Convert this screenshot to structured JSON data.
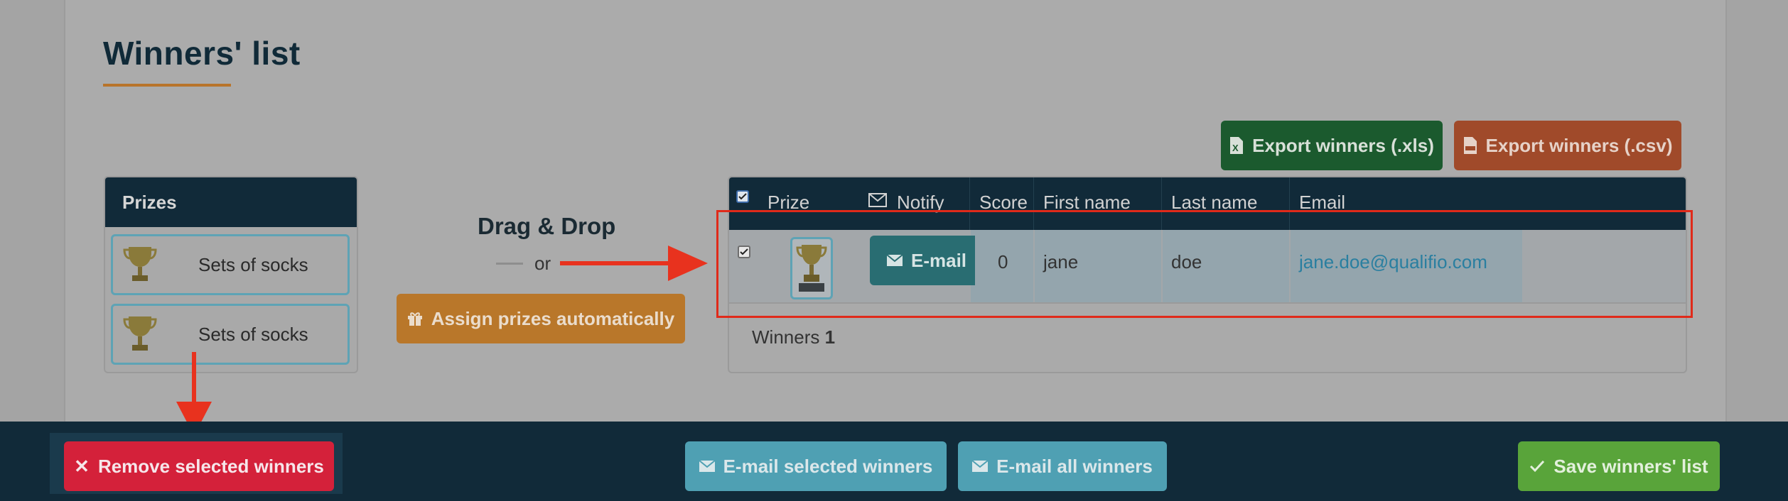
{
  "page": {
    "title": "Winners' list"
  },
  "export": {
    "xls_label": "Export winners (.xls)",
    "csv_label": "Export winners (.csv)"
  },
  "prizes": {
    "heading": "Prizes",
    "items": [
      {
        "label": "Sets of socks"
      },
      {
        "label": "Sets of socks"
      }
    ]
  },
  "drag_drop": {
    "title": "Drag & Drop",
    "or": "or",
    "assign_label": "Assign prizes automatically"
  },
  "table": {
    "headers": {
      "prize": "Prize",
      "notify": "Notify",
      "score": "Score",
      "first_name": "First name",
      "last_name": "Last name",
      "email": "Email"
    },
    "rows": [
      {
        "checked": true,
        "notify_label": "E-mail",
        "score": "0",
        "first_name": "jane",
        "last_name": "doe",
        "email": "jane.doe@qualifio.com"
      }
    ],
    "footer_label": "Winners",
    "footer_count": "1"
  },
  "bottom_bar": {
    "remove_label": "Remove selected winners",
    "email_selected_label": "E-mail selected winners",
    "email_all_label": "E-mail all winners",
    "save_label": "Save winners' list"
  },
  "colors": {
    "accent": "#b8742a",
    "dark": "#112a39",
    "danger": "#d4213a",
    "success": "#59a43a",
    "info": "#4fa0b3",
    "annotation": "#e02a1a"
  }
}
